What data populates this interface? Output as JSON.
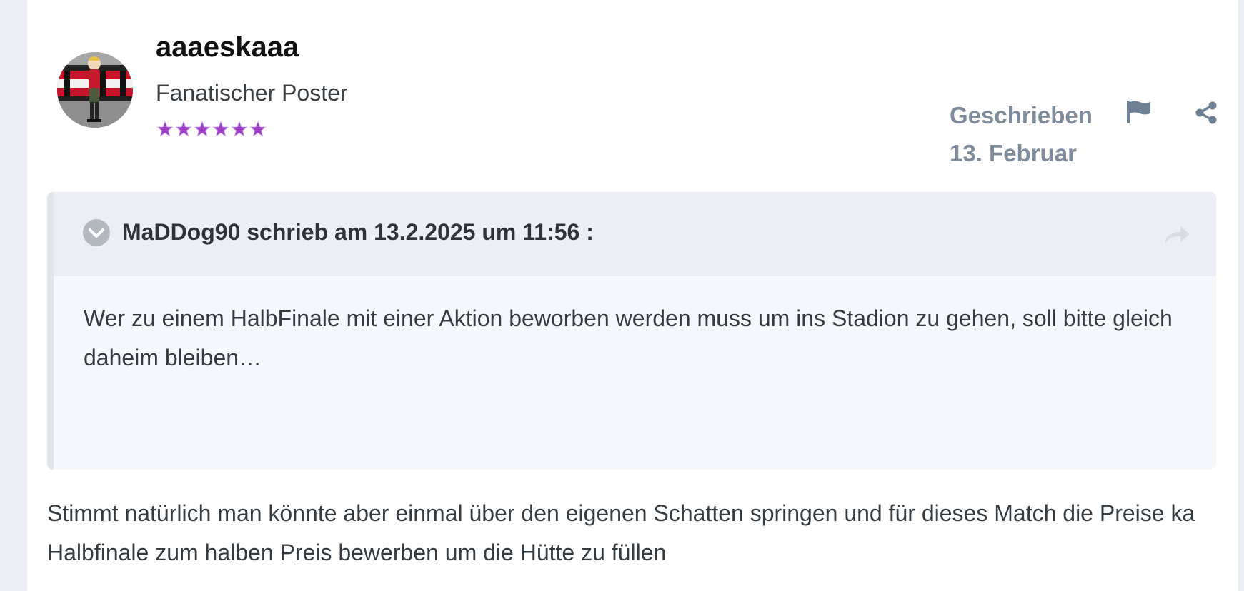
{
  "author": {
    "name": "aaaeskaaa",
    "rank": "Fanatischer Poster",
    "stars": 6,
    "star_color": "#9b3fc7"
  },
  "meta": {
    "written_label": "Geschrieben",
    "date": "13. Februar"
  },
  "icons": {
    "report": "flag-icon",
    "share": "share-icon",
    "collapse": "chevron-down-icon",
    "goto": "reply-arrow-icon"
  },
  "quote": {
    "citation": "MaDDog90 schrieb am 13.2.2025 um 11:56 :",
    "text": "Wer zu einem HalbFinale mit einer Aktion beworben werden muss um ins Stadion zu gehen, soll bitte gleich daheim bleiben…"
  },
  "post": {
    "text": "Stimmt natürlich man könnte aber einmal über den eigenen Schatten springen und für dieses Match die Preise ka Halbfinale zum halben Preis bewerben um die Hütte zu füllen"
  },
  "colors": {
    "meta_text": "#7d8b9a",
    "quote_background": "#f5f7fa",
    "quote_header": "#ebeef2"
  }
}
